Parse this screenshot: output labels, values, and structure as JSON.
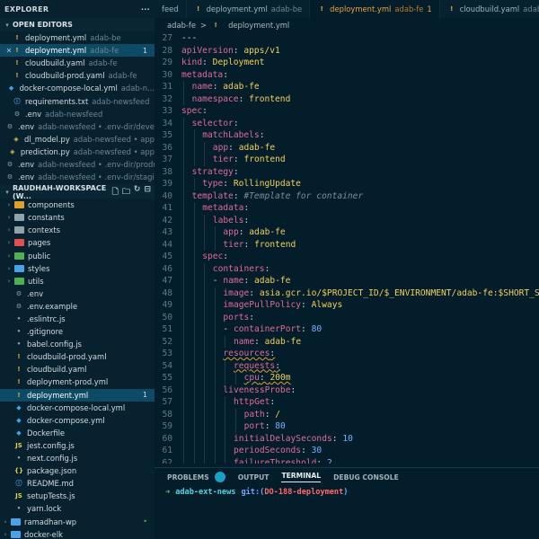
{
  "sidebar": {
    "title": "EXPLORER",
    "open_editors_label": "OPEN EDITORS",
    "open_editors": [
      {
        "name": "deployment.yml",
        "hint": "adab-be",
        "icon": "yaml",
        "active": false,
        "badge": ""
      },
      {
        "name": "deployment.yml",
        "hint": "adab-fe",
        "icon": "yaml",
        "active": true,
        "badge": "1"
      },
      {
        "name": "cloudbuild.yaml",
        "hint": "adab-fe",
        "icon": "yaml",
        "active": false,
        "badge": ""
      },
      {
        "name": "cloudbuild-prod.yaml",
        "hint": "adab-fe",
        "icon": "yaml",
        "active": false,
        "badge": ""
      },
      {
        "name": "docker-compose-local.yml",
        "hint": "adab-n...",
        "icon": "docker",
        "active": false,
        "badge": ""
      },
      {
        "name": "requirements.txt",
        "hint": "adab-newsfeed",
        "icon": "info",
        "active": false,
        "badge": ""
      },
      {
        "name": ".env",
        "hint": "adab-newsfeed",
        "icon": "gear",
        "active": false,
        "badge": ""
      },
      {
        "name": ".env",
        "hint": "adab-newsfeed • .env-dir/devel...",
        "icon": "gear",
        "active": false,
        "badge": ""
      },
      {
        "name": "dl_model.py",
        "hint": "adab-newsfeed • app",
        "icon": "py",
        "active": false,
        "badge": ""
      },
      {
        "name": "prediction.py",
        "hint": "adab-newsfeed • app",
        "icon": "py",
        "active": false,
        "badge": ""
      },
      {
        "name": ".env",
        "hint": "adab-newsfeed • .env-dir/produ...",
        "icon": "gear",
        "active": false,
        "badge": ""
      },
      {
        "name": ".env",
        "hint": "adab-newsfeed • .env-dir/staging",
        "icon": "gear",
        "active": false,
        "badge": ""
      }
    ],
    "workspace_label": "RAUDHAH-WORKSPACE (W...",
    "folders": [
      {
        "name": "components",
        "color": "#e0a030"
      },
      {
        "name": "constants",
        "color": "#8fa3ad"
      },
      {
        "name": "contexts",
        "color": "#8fa3ad"
      },
      {
        "name": "pages",
        "color": "#e05050"
      },
      {
        "name": "public",
        "color": "#4fb04f"
      },
      {
        "name": "styles",
        "color": "#49a3e6"
      },
      {
        "name": "utils",
        "color": "#4fb04f"
      }
    ],
    "files": [
      {
        "name": ".env",
        "icon": "gear",
        "active": false,
        "badge": ""
      },
      {
        "name": ".env.example",
        "icon": "gear",
        "active": false,
        "badge": ""
      },
      {
        "name": ".eslintrc.js",
        "icon": "dot",
        "active": false,
        "badge": ""
      },
      {
        "name": ".gitignore",
        "icon": "dot",
        "active": false,
        "badge": ""
      },
      {
        "name": "babel.config.js",
        "icon": "dot",
        "active": false,
        "badge": ""
      },
      {
        "name": "cloudbuild-prod.yaml",
        "icon": "yaml",
        "active": false,
        "badge": ""
      },
      {
        "name": "cloudbuild.yaml",
        "icon": "yaml",
        "active": false,
        "badge": ""
      },
      {
        "name": "deployment-prod.yml",
        "icon": "yaml",
        "active": false,
        "badge": ""
      },
      {
        "name": "deployment.yml",
        "icon": "yaml",
        "active": true,
        "badge": "1"
      },
      {
        "name": "docker-compose-local.yml",
        "icon": "docker",
        "active": false,
        "badge": ""
      },
      {
        "name": "docker-compose.yml",
        "icon": "docker",
        "active": false,
        "badge": ""
      },
      {
        "name": "Dockerfile",
        "icon": "docker",
        "active": false,
        "badge": ""
      },
      {
        "name": "jest.config.js",
        "icon": "js",
        "active": false,
        "badge": ""
      },
      {
        "name": "next.config.js",
        "icon": "dot",
        "active": false,
        "badge": ""
      },
      {
        "name": "package.json",
        "icon": "json",
        "active": false,
        "badge": ""
      },
      {
        "name": "README.md",
        "icon": "info",
        "active": false,
        "badge": ""
      },
      {
        "name": "setupTests.js",
        "icon": "js",
        "active": false,
        "badge": ""
      },
      {
        "name": "yarn.lock",
        "icon": "dot",
        "active": false,
        "badge": ""
      }
    ],
    "bottom_workspaces": [
      {
        "name": "ramadhan-wp",
        "badge": "•"
      },
      {
        "name": "docker-elk",
        "badge": ""
      }
    ]
  },
  "tabs": [
    {
      "label": "feed",
      "dir": "",
      "num": "",
      "active": false
    },
    {
      "label": "deployment.yml",
      "dir": "adab-be",
      "num": "",
      "active": false
    },
    {
      "label": "deployment.yml",
      "dir": "adab-fe",
      "num": "1",
      "active": true
    },
    {
      "label": "cloudbuild.yaml",
      "dir": "adab-fe",
      "num": "",
      "active": false
    }
  ],
  "breadcrumb": {
    "folder": "adab-fe",
    "sep": ">",
    "file": "deployment.yml"
  },
  "code": [
    {
      "n": "27",
      "indent": 0,
      "parts": [
        [
          "p",
          "---"
        ]
      ]
    },
    {
      "n": "28",
      "indent": 0,
      "parts": [
        [
          "k",
          "apiVersion"
        ],
        [
          "p",
          ": "
        ],
        [
          "v",
          "apps/v1"
        ]
      ]
    },
    {
      "n": "29",
      "indent": 0,
      "parts": [
        [
          "k",
          "kind"
        ],
        [
          "p",
          ": "
        ],
        [
          "v",
          "Deployment"
        ]
      ]
    },
    {
      "n": "30",
      "indent": 0,
      "parts": [
        [
          "k",
          "metadata"
        ],
        [
          "p",
          ":"
        ]
      ]
    },
    {
      "n": "31",
      "indent": 1,
      "parts": [
        [
          "k",
          "name"
        ],
        [
          "p",
          ": "
        ],
        [
          "v",
          "adab-fe"
        ]
      ]
    },
    {
      "n": "32",
      "indent": 1,
      "parts": [
        [
          "k",
          "namespace"
        ],
        [
          "p",
          ": "
        ],
        [
          "v",
          "frontend"
        ]
      ]
    },
    {
      "n": "33",
      "indent": 0,
      "parts": [
        [
          "k",
          "spec"
        ],
        [
          "p",
          ":"
        ]
      ]
    },
    {
      "n": "34",
      "indent": 1,
      "parts": [
        [
          "k",
          "selector"
        ],
        [
          "p",
          ":"
        ]
      ]
    },
    {
      "n": "35",
      "indent": 2,
      "parts": [
        [
          "k",
          "matchLabels"
        ],
        [
          "p",
          ":"
        ]
      ]
    },
    {
      "n": "36",
      "indent": 3,
      "parts": [
        [
          "k",
          "app"
        ],
        [
          "p",
          ": "
        ],
        [
          "v",
          "adab-fe"
        ]
      ]
    },
    {
      "n": "37",
      "indent": 3,
      "parts": [
        [
          "k",
          "tier"
        ],
        [
          "p",
          ": "
        ],
        [
          "v",
          "frontend"
        ]
      ]
    },
    {
      "n": "38",
      "indent": 1,
      "parts": [
        [
          "k",
          "strategy"
        ],
        [
          "p",
          ":"
        ]
      ]
    },
    {
      "n": "39",
      "indent": 2,
      "parts": [
        [
          "k",
          "type"
        ],
        [
          "p",
          ": "
        ],
        [
          "v",
          "RollingUpdate"
        ]
      ]
    },
    {
      "n": "40",
      "indent": 1,
      "parts": [
        [
          "k",
          "template"
        ],
        [
          "p",
          ": "
        ],
        [
          "c",
          "#Template for container"
        ]
      ]
    },
    {
      "n": "41",
      "indent": 2,
      "parts": [
        [
          "k",
          "metadata"
        ],
        [
          "p",
          ":"
        ]
      ]
    },
    {
      "n": "42",
      "indent": 3,
      "parts": [
        [
          "k",
          "labels"
        ],
        [
          "p",
          ":"
        ]
      ]
    },
    {
      "n": "43",
      "indent": 4,
      "parts": [
        [
          "k",
          "app"
        ],
        [
          "p",
          ": "
        ],
        [
          "v",
          "adab-fe"
        ]
      ]
    },
    {
      "n": "44",
      "indent": 4,
      "parts": [
        [
          "k",
          "tier"
        ],
        [
          "p",
          ": "
        ],
        [
          "v",
          "frontend"
        ]
      ]
    },
    {
      "n": "45",
      "indent": 2,
      "parts": [
        [
          "k",
          "spec"
        ],
        [
          "p",
          ":"
        ]
      ]
    },
    {
      "n": "46",
      "indent": 3,
      "parts": [
        [
          "k",
          "containers"
        ],
        [
          "p",
          ":"
        ]
      ]
    },
    {
      "n": "47",
      "indent": 3,
      "parts": [
        [
          "p",
          "- "
        ],
        [
          "k",
          "name"
        ],
        [
          "p",
          ": "
        ],
        [
          "v",
          "adab-fe"
        ]
      ]
    },
    {
      "n": "48",
      "indent": 4,
      "parts": [
        [
          "k",
          "image"
        ],
        [
          "p",
          ": "
        ],
        [
          "v",
          "asia.gcr.io/$PROJECT_ID/$_ENVIRONMENT/adab-fe:$SHORT_SHA"
        ]
      ]
    },
    {
      "n": "49",
      "indent": 4,
      "parts": [
        [
          "k",
          "imagePullPolicy"
        ],
        [
          "p",
          ": "
        ],
        [
          "v",
          "Always"
        ]
      ]
    },
    {
      "n": "50",
      "indent": 4,
      "parts": [
        [
          "k",
          "ports"
        ],
        [
          "p",
          ":"
        ]
      ]
    },
    {
      "n": "51",
      "indent": 4,
      "parts": [
        [
          "p",
          "- "
        ],
        [
          "k",
          "containerPort"
        ],
        [
          "p",
          ": "
        ],
        [
          "n",
          "80"
        ]
      ]
    },
    {
      "n": "52",
      "indent": 5,
      "parts": [
        [
          "k",
          "name"
        ],
        [
          "p",
          ": "
        ],
        [
          "v",
          "adab-fe"
        ]
      ]
    },
    {
      "n": "53",
      "indent": 4,
      "squig": true,
      "parts": [
        [
          "k",
          "resources"
        ],
        [
          "p",
          ":"
        ]
      ]
    },
    {
      "n": "54",
      "indent": 5,
      "squig": true,
      "parts": [
        [
          "k",
          "requests"
        ],
        [
          "p",
          ":"
        ]
      ]
    },
    {
      "n": "55",
      "indent": 6,
      "squig": true,
      "parts": [
        [
          "k",
          "cpu"
        ],
        [
          "p",
          ": "
        ],
        [
          "v",
          "200m"
        ]
      ]
    },
    {
      "n": "56",
      "indent": 4,
      "parts": [
        [
          "k",
          "livenessProbe"
        ],
        [
          "p",
          ":"
        ]
      ]
    },
    {
      "n": "57",
      "indent": 5,
      "parts": [
        [
          "k",
          "httpGet"
        ],
        [
          "p",
          ":"
        ]
      ]
    },
    {
      "n": "58",
      "indent": 6,
      "parts": [
        [
          "k",
          "path"
        ],
        [
          "p",
          ": "
        ],
        [
          "v",
          "/"
        ]
      ]
    },
    {
      "n": "59",
      "indent": 6,
      "parts": [
        [
          "k",
          "port"
        ],
        [
          "p",
          ": "
        ],
        [
          "n",
          "80"
        ]
      ]
    },
    {
      "n": "60",
      "indent": 5,
      "parts": [
        [
          "k",
          "initialDelaySeconds"
        ],
        [
          "p",
          ": "
        ],
        [
          "n",
          "10"
        ]
      ]
    },
    {
      "n": "61",
      "indent": 5,
      "parts": [
        [
          "k",
          "periodSeconds"
        ],
        [
          "p",
          ": "
        ],
        [
          "n",
          "30"
        ]
      ]
    },
    {
      "n": "62",
      "indent": 5,
      "parts": [
        [
          "k",
          "failureThreshold"
        ],
        [
          "p",
          ": "
        ],
        [
          "n",
          "2"
        ]
      ]
    }
  ],
  "panel": {
    "tabs": [
      {
        "label": "PROBLEMS",
        "active": false
      },
      {
        "label": "OUTPUT",
        "active": false
      },
      {
        "label": "TERMINAL",
        "active": true
      },
      {
        "label": "DEBUG CONSOLE",
        "active": false
      }
    ],
    "terminal": {
      "arrow": "➜",
      "dir": "adab-ext-news",
      "git": "git:(",
      "branch": "DO-188-deployment",
      "git_end": ")"
    }
  }
}
